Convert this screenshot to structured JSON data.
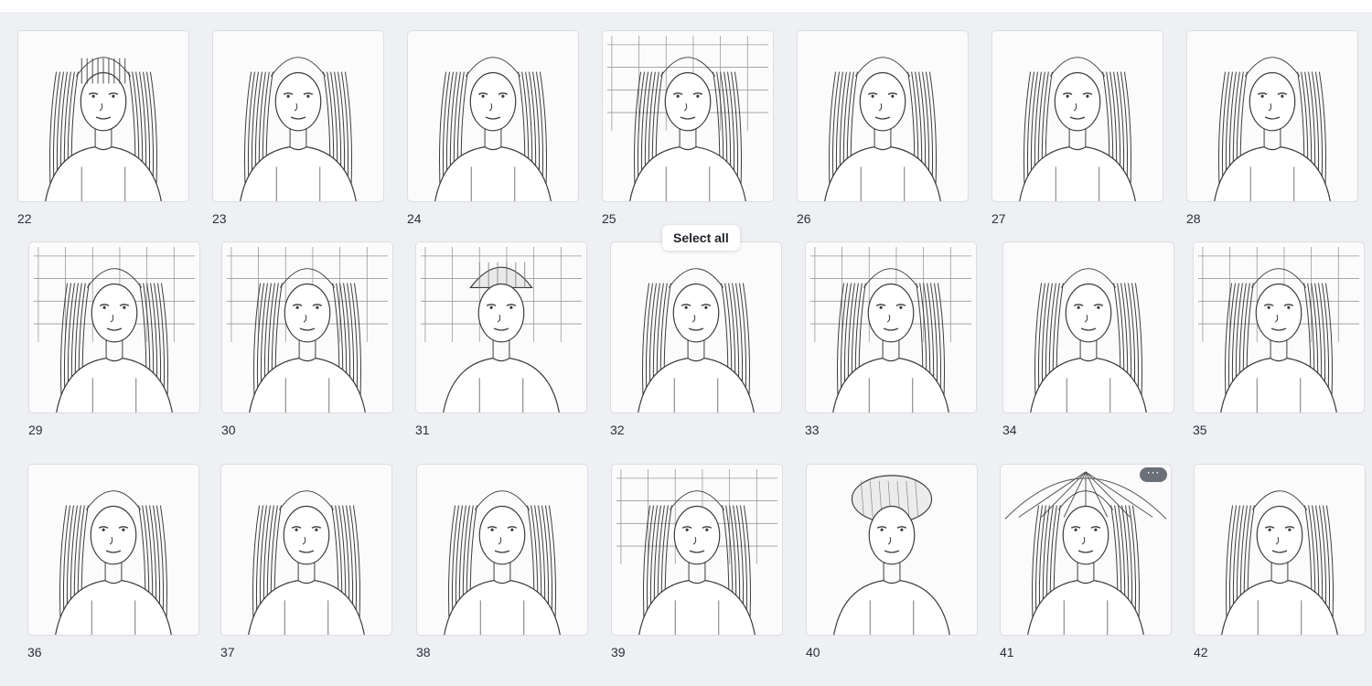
{
  "tooltip": {
    "label": "Select all"
  },
  "more_button": {
    "icon": "more-horizontal-icon",
    "label": "···"
  },
  "pages": [
    {
      "number": "22",
      "style": "bangs"
    },
    {
      "number": "23",
      "style": "back"
    },
    {
      "number": "24",
      "style": "curls"
    },
    {
      "number": "25",
      "style": "bridge"
    },
    {
      "number": "26",
      "style": "ponytail"
    },
    {
      "number": "27",
      "style": "curls-close"
    },
    {
      "number": "28",
      "style": "braids-close"
    },
    {
      "number": "29",
      "style": "office"
    },
    {
      "number": "30",
      "style": "selfie"
    },
    {
      "number": "31",
      "style": "beanie"
    },
    {
      "number": "32",
      "style": "plain"
    },
    {
      "number": "33",
      "style": "party"
    },
    {
      "number": "34",
      "style": "braids-side"
    },
    {
      "number": "35",
      "style": "room"
    },
    {
      "number": "36",
      "style": "braids-front"
    },
    {
      "number": "37",
      "style": "wave"
    },
    {
      "number": "38",
      "style": "suit"
    },
    {
      "number": "39",
      "style": "city"
    },
    {
      "number": "40",
      "style": "fur-hat"
    },
    {
      "number": "41",
      "style": "umbrella"
    },
    {
      "number": "42",
      "style": "straight"
    }
  ]
}
